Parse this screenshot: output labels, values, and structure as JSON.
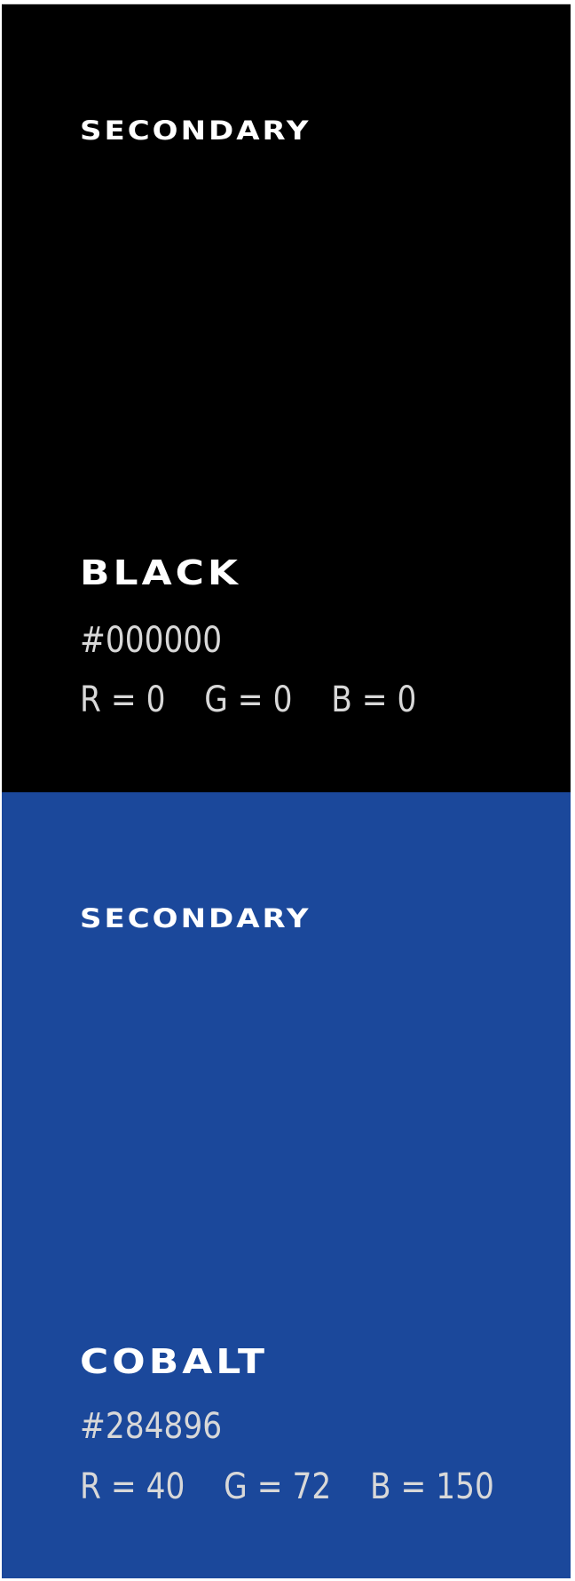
{
  "swatches": [
    {
      "category": "SECONDARY",
      "name": "BLACK",
      "hex": "#000000",
      "rgb": "R = 0    G = 0    B = 0",
      "color": "#000000"
    },
    {
      "category": "SECONDARY",
      "name": "COBALT",
      "hex": "#284896",
      "rgb": "R = 40    G = 72    B = 150",
      "color": "#1b489b"
    }
  ]
}
